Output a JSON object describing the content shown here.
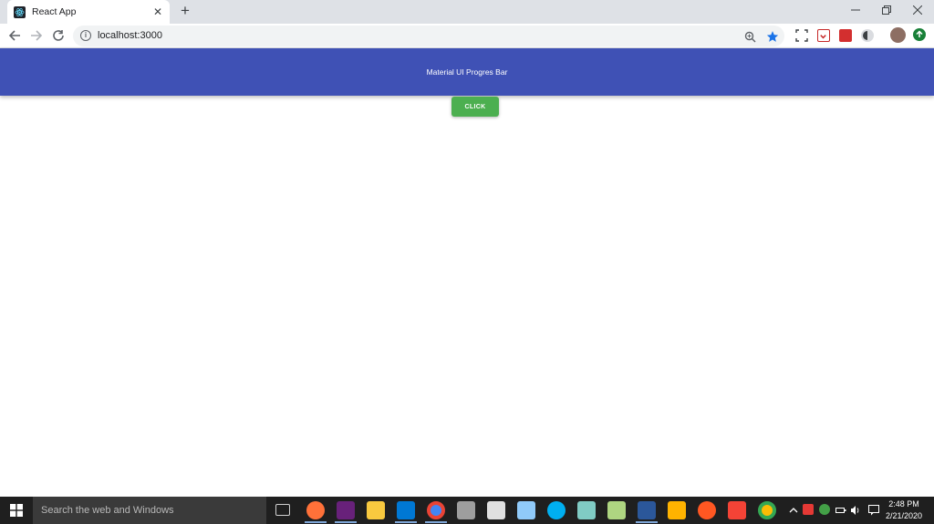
{
  "browser": {
    "tab_title": "React App",
    "url": "localhost:3000",
    "new_tab_label": "+"
  },
  "app": {
    "title": "Material UI Progres Bar",
    "button_label": "CLICK"
  },
  "taskbar": {
    "search_placeholder": "Search the web and Windows",
    "time": "2:48 PM",
    "date": "2/21/2020"
  },
  "colors": {
    "appbar": "#3f51b5",
    "button": "#4caf50",
    "taskbar": "#1f1f1f"
  }
}
